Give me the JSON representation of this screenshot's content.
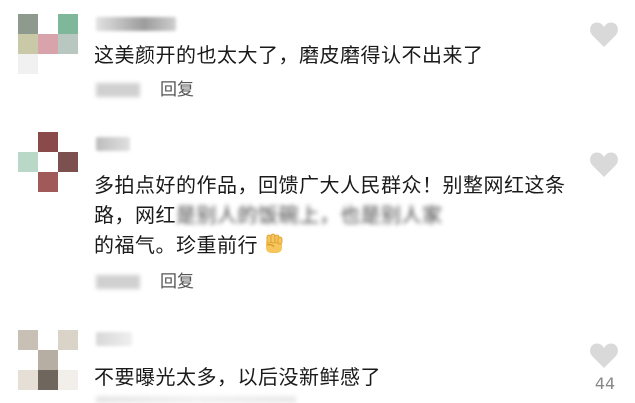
{
  "reply_label": "回复",
  "comments": [
    {
      "text": "这美颜开的也太大了，磨皮磨得认不出来了"
    },
    {
      "text_part1": "多拍点好的作品，回馈广大人民群众！别整网红这条路，网红",
      "text_blurred": "是别人的饭碗上，也是别人家",
      "text_part2": "的福气。珍重前行",
      "emoji": "fist-emoji"
    },
    {
      "text": "不要曝光太多，以后没新鲜感了",
      "like_count": "44"
    }
  ],
  "colors": {
    "text": "#1a1a1a",
    "reply": "#555555",
    "like_icon": "#d9d9d9",
    "like_count": "#888888"
  }
}
